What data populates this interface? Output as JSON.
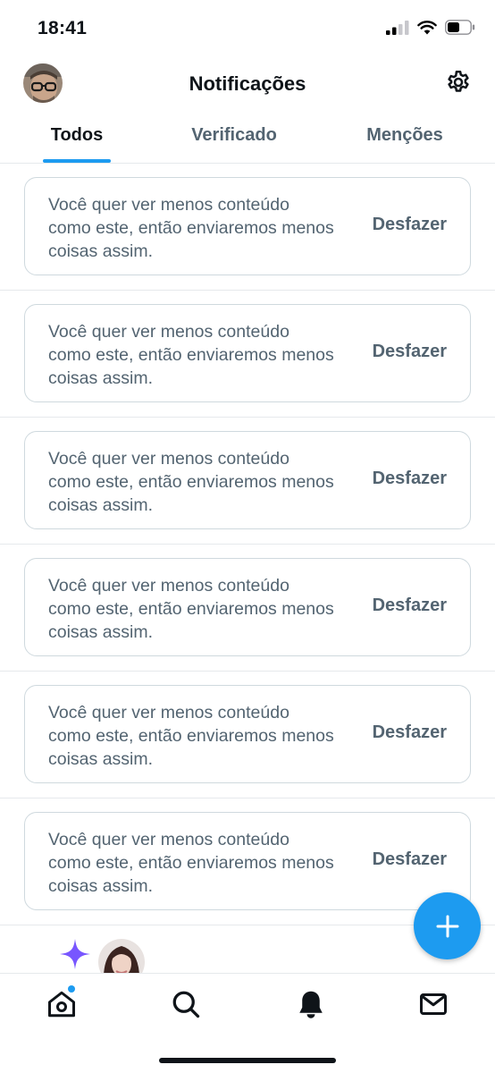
{
  "status_bar": {
    "time": "18:41",
    "icons": [
      "cellular-signal-icon",
      "wifi-icon",
      "battery-icon"
    ]
  },
  "header": {
    "title": "Notificações",
    "avatar_icon": "user-avatar",
    "settings_icon": "gear-icon"
  },
  "tabs": [
    {
      "label": "Todos",
      "active": true
    },
    {
      "label": "Verificado",
      "active": false
    },
    {
      "label": "Menções",
      "active": false
    }
  ],
  "notifications": [
    {
      "text": "Você quer ver menos conteúdo como este, então enviaremos menos coisas assim.",
      "action": "Desfazer"
    },
    {
      "text": "Você quer ver menos conteúdo como este, então enviaremos menos coisas assim.",
      "action": "Desfazer"
    },
    {
      "text": "Você quer ver menos conteúdo como este, então enviaremos menos coisas assim.",
      "action": "Desfazer"
    },
    {
      "text": "Você quer ver menos conteúdo como este, então enviaremos menos coisas assim.",
      "action": "Desfazer"
    },
    {
      "text": "Você quer ver menos conteúdo como este, então enviaremos menos coisas assim.",
      "action": "Desfazer"
    },
    {
      "text": "Você quer ver menos conteúdo como este, então enviaremos menos coisas assim.",
      "action": "Desfazer"
    }
  ],
  "fab": {
    "icon": "plus-icon"
  },
  "bottom_nav": [
    {
      "name": "home",
      "icon": "home-icon",
      "has_badge": true
    },
    {
      "name": "search",
      "icon": "search-icon"
    },
    {
      "name": "notifications",
      "icon": "bell-icon",
      "active": true
    },
    {
      "name": "messages",
      "icon": "mail-icon"
    }
  ],
  "colors": {
    "accent": "#1d9bf0",
    "text_primary": "#0f1419",
    "text_secondary": "#536471",
    "border": "#cfd9de",
    "divider": "#e6e9ec",
    "sparkle": "#7856ff"
  }
}
